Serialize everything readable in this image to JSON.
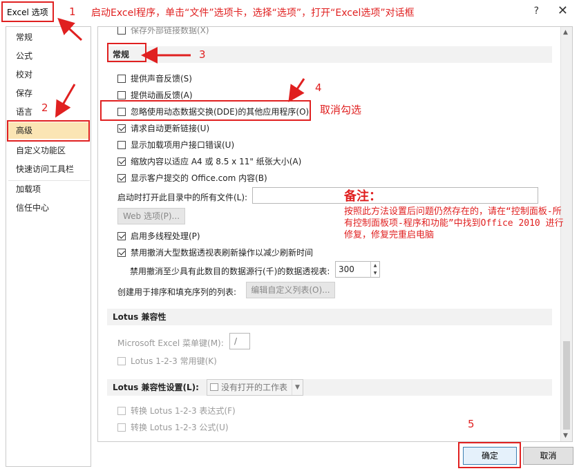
{
  "window": {
    "title": "Excel 选项",
    "help": "?",
    "close": "✕"
  },
  "sidebar": {
    "items": [
      {
        "label": "常规",
        "active": false
      },
      {
        "label": "公式",
        "active": false
      },
      {
        "label": "校对",
        "active": false
      },
      {
        "label": "保存",
        "active": false
      },
      {
        "label": "语言",
        "active": false
      },
      {
        "label": "高级",
        "active": true
      },
      {
        "label": "自定义功能区",
        "active": false
      },
      {
        "label": "快速访问工具栏",
        "active": false
      },
      {
        "label": "加载项",
        "active": false
      },
      {
        "label": "信任中心",
        "active": false
      }
    ]
  },
  "content": {
    "cut_off_item": "保存外部链接数据(X)",
    "general_header": "常规",
    "options": [
      {
        "label": "提供声音反馈(S)",
        "checked": false
      },
      {
        "label": "提供动画反馈(A)",
        "checked": false
      },
      {
        "label": "忽略使用动态数据交换(DDE)的其他应用程序(O)",
        "checked": false
      },
      {
        "label": "请求自动更新链接(U)",
        "checked": true
      },
      {
        "label": "显示加载项用户接口错误(U)",
        "checked": false
      },
      {
        "label": "缩放内容以适应 A4 或 8.5 x 11\" 纸张大小(A)",
        "checked": true
      },
      {
        "label": "显示客户提交的 Office.com 内容(B)",
        "checked": true
      }
    ],
    "startup_label": "启动时打开此目录中的所有文件(L):",
    "startup_value": "",
    "web_options": "Web 选项(P)...",
    "multithread": {
      "label": "启用多线程处理(P)",
      "checked": true
    },
    "pivot_undo": {
      "label": "禁用撤消大型数据透视表刷新操作以减少刷新时间",
      "checked": true
    },
    "pivot_rows_label": "禁用撤消至少具有此数目的数据源行(千)的数据透视表:",
    "pivot_rows_value": "300",
    "custom_lists_label": "创建用于排序和填充序列的列表:",
    "custom_lists_btn": "编辑自定义列表(O)...",
    "lotus_header": "Lotus 兼容性",
    "menu_key_label": "Microsoft Excel 菜单键(M):",
    "menu_key_value": "/",
    "lotus_nav_keys": "Lotus 1-2-3 常用键(K)",
    "lotus_settings_header": "Lotus 兼容性设置(L):",
    "lotus_settings_combo": "没有打开的工作表",
    "lotus_expr": "转换 Lotus 1-2-3 表达式(F)",
    "lotus_formula": "转换 Lotus 1-2-3 公式(U)"
  },
  "footer": {
    "ok": "确定",
    "cancel": "取消"
  },
  "annotations": {
    "step1_num": "1",
    "step1_text": "启动Excel程序，单击“文件”选项卡，选择“选项”，打开“Excel选项”对话框",
    "step2_num": "2",
    "step3_num": "3",
    "step4_num": "4",
    "step4_text": "取消勾选",
    "step5_num": "5",
    "note_title": "备注：",
    "note_body": "按照此方法设置后问题仍然存在的，请在“控制面板-所有控制面板项-程序和功能”中找到Office 2010 进行修复，修复完重启电脑",
    "accent_color": "#e02020"
  }
}
